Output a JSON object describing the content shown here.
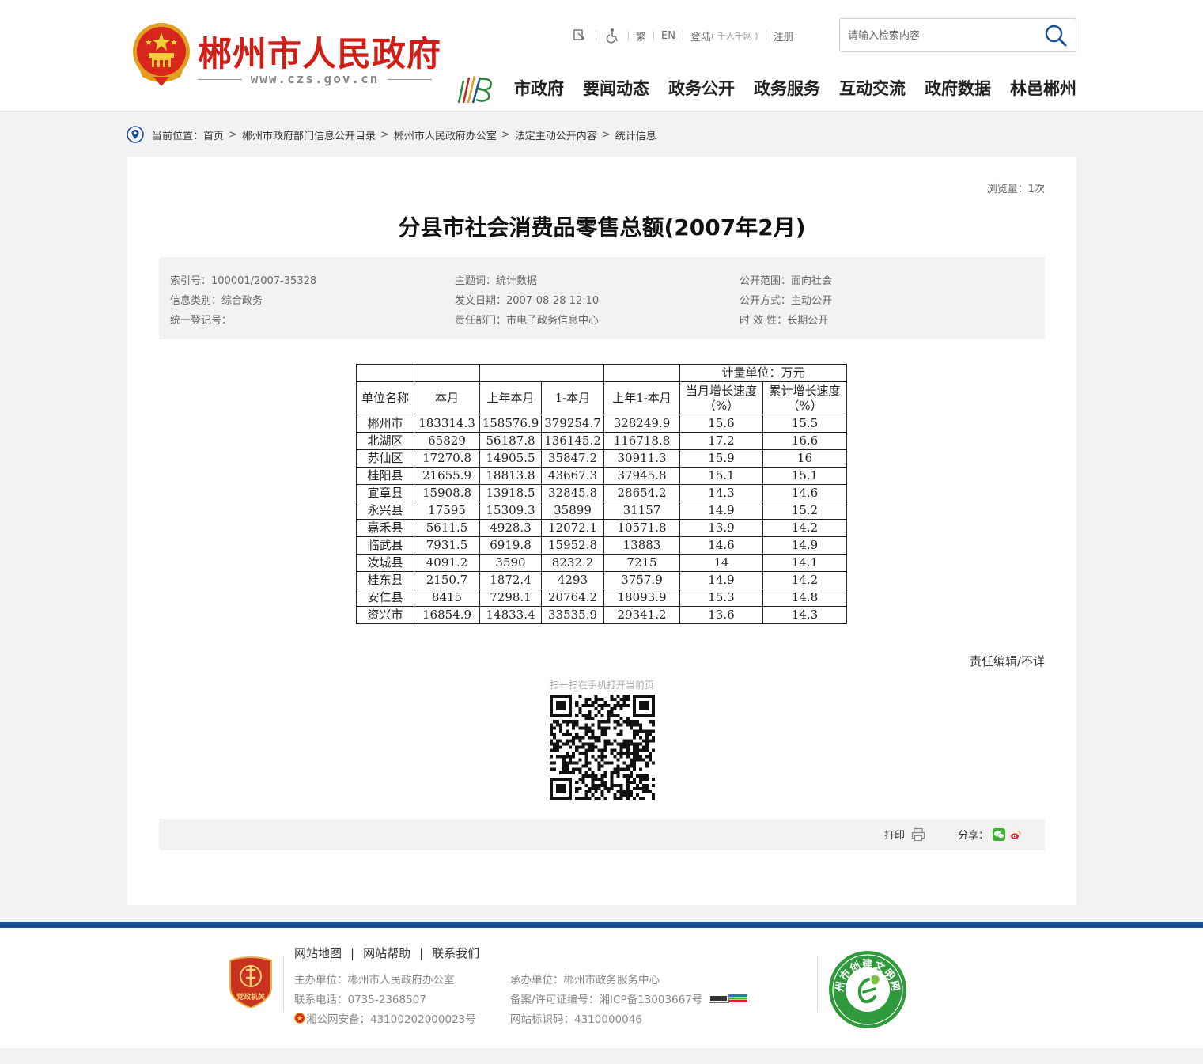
{
  "header": {
    "site_name": "郴州市人民政府",
    "site_url": "www.czs.gov.cn",
    "topbar": {
      "traditional": "繁",
      "english": "EN",
      "login": "登陆",
      "login_note": "( 千人千网 )",
      "register": "注册"
    },
    "search": {
      "placeholder": "请输入检索内容"
    },
    "nav": [
      "市政府",
      "要闻动态",
      "政务公开",
      "政务服务",
      "互动交流",
      "政府数据",
      "林邑郴州"
    ]
  },
  "breadcrumb": {
    "label": "当前位置：",
    "items": [
      "首页",
      "郴州市政府部门信息公开目录",
      "郴州市人民政府办公室",
      "法定主动公开内容",
      "统计信息"
    ]
  },
  "article": {
    "views": "浏览量：1次",
    "title": "分县市社会消费品零售总额(2007年2月)",
    "meta": {
      "index_no": "索引号：100001/2007-35328",
      "subject": "主题词：统计数据",
      "scope": "公开范围：面向社会",
      "category": "信息类别：综合政务",
      "date": "发文日期：2007-08-28 12:10",
      "method": "公开方式：主动公开",
      "reg_no": "统一登记号：",
      "dept": "责任部门：市电子政务信息中心",
      "validity": "时 效 性：长期公开"
    },
    "table": {
      "unit": "计量单位：万元",
      "headers": [
        "单位名称",
        "本月",
        "上年本月",
        "1-本月",
        "上年1-本月",
        "当月增长速度（%）",
        "累计增长速度（%）"
      ],
      "rows": [
        [
          "郴州市",
          "183314.3",
          "158576.9",
          "379254.7",
          "328249.9",
          "15.6",
          "15.5"
        ],
        [
          "北湖区",
          "65829",
          "56187.8",
          "136145.2",
          "116718.8",
          "17.2",
          "16.6"
        ],
        [
          "苏仙区",
          "17270.8",
          "14905.5",
          "35847.2",
          "30911.3",
          "15.9",
          "16"
        ],
        [
          "桂阳县",
          "21655.9",
          "18813.8",
          "43667.3",
          "37945.8",
          "15.1",
          "15.1"
        ],
        [
          "宜章县",
          "15908.8",
          "13918.5",
          "32845.8",
          "28654.2",
          "14.3",
          "14.6"
        ],
        [
          "永兴县",
          "17595",
          "15309.3",
          "35899",
          "31157",
          "14.9",
          "15.2"
        ],
        [
          "嘉禾县",
          "5611.5",
          "4928.3",
          "12072.1",
          "10571.8",
          "13.9",
          "14.2"
        ],
        [
          "临武县",
          "7931.5",
          "6919.8",
          "15952.8",
          "13883",
          "14.6",
          "14.9"
        ],
        [
          "汝城县",
          "4091.2",
          "3590",
          "8232.2",
          "7215",
          "14",
          "14.1"
        ],
        [
          "桂东县",
          "2150.7",
          "1872.4",
          "4293",
          "3757.9",
          "14.9",
          "14.2"
        ],
        [
          "安仁县",
          "8415",
          "7298.1",
          "20764.2",
          "18093.9",
          "15.3",
          "14.8"
        ],
        [
          "资兴市",
          "16854.9",
          "14833.4",
          "33535.9",
          "29341.2",
          "13.6",
          "14.3"
        ]
      ]
    },
    "editor": "责任编辑/不详",
    "qr_caption": "扫一扫在手机打开当前页",
    "print_label": "打印",
    "share_label": "分享："
  },
  "footer": {
    "links": [
      "网站地图",
      "网站帮助",
      "联系我们"
    ],
    "sponsor": "主办单位：郴州市人民政府办公室",
    "phone": "联系电话：0735-2368507",
    "police": "湘公网安备：43100202000023号",
    "organizer": "承办单位：郴州市政务服务中心",
    "icp": "备案/许可证编号：湘ICP备13003667号",
    "site_code": "网站标识码：4310000046",
    "badge_text": "党政机关",
    "seal_text": "郴州市创建文明网站"
  },
  "colors": {
    "brand_red": "#d11f18",
    "footer_blue": "#1a4e95",
    "nav_text": "#222222",
    "meta_bg": "#f2f2f2"
  },
  "icons": [
    "emblem-icon",
    "wechat-icon",
    "weibo-icon",
    "print-icon",
    "search-icon",
    "location-pin-icon",
    "accessibility-icon",
    "font-size-icon"
  ]
}
